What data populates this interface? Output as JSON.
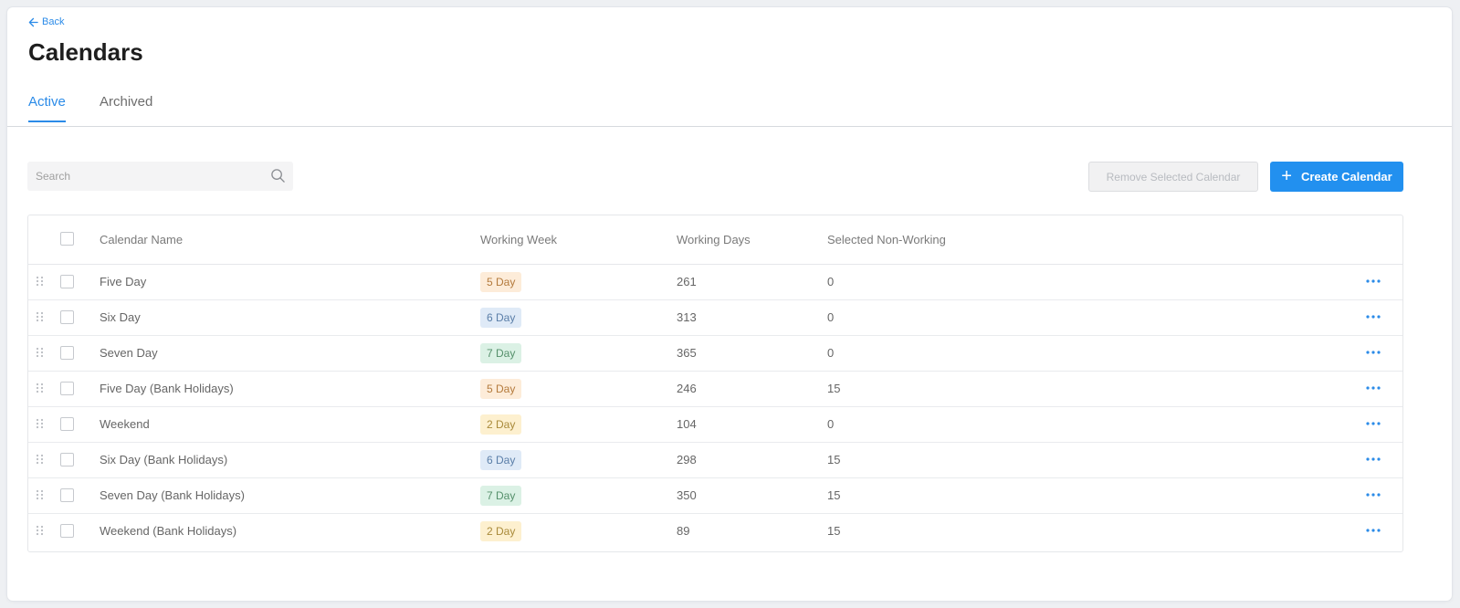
{
  "nav": {
    "back_label": "Back"
  },
  "page": {
    "title": "Calendars"
  },
  "tabs": [
    {
      "label": "Active",
      "active": true
    },
    {
      "label": "Archived",
      "active": false
    }
  ],
  "search": {
    "placeholder": "Search",
    "value": ""
  },
  "actions": {
    "remove_label": "Remove Selected Calendar",
    "create_label": "Create Calendar",
    "create_icon": "+"
  },
  "table": {
    "columns": [
      "Calendar Name",
      "Working Week",
      "Working Days",
      "Selected Non-Working"
    ],
    "rows": [
      {
        "name": "Five Day",
        "week": "5 Day",
        "days": "261",
        "non_working": "0"
      },
      {
        "name": "Six Day",
        "week": "6 Day",
        "days": "313",
        "non_working": "0"
      },
      {
        "name": "Seven Day",
        "week": "7 Day",
        "days": "365",
        "non_working": "0"
      },
      {
        "name": "Five Day (Bank Holidays)",
        "week": "5 Day",
        "days": "246",
        "non_working": "15"
      },
      {
        "name": "Weekend",
        "week": "2 Day",
        "days": "104",
        "non_working": "0"
      },
      {
        "name": "Six Day (Bank Holidays)",
        "week": "6 Day",
        "days": "298",
        "non_working": "15"
      },
      {
        "name": "Seven Day (Bank Holidays)",
        "week": "7 Day",
        "days": "350",
        "non_working": "15"
      },
      {
        "name": "Weekend (Bank Holidays)",
        "week": "2 Day",
        "days": "89",
        "non_working": "15"
      }
    ]
  },
  "colors": {
    "accent": "#2290ef",
    "badge_5_day": "#fdecd9",
    "badge_6_day": "#dfeaf7",
    "badge_7_day": "#dbf1e5",
    "badge_2_day": "#fdf0cf"
  }
}
